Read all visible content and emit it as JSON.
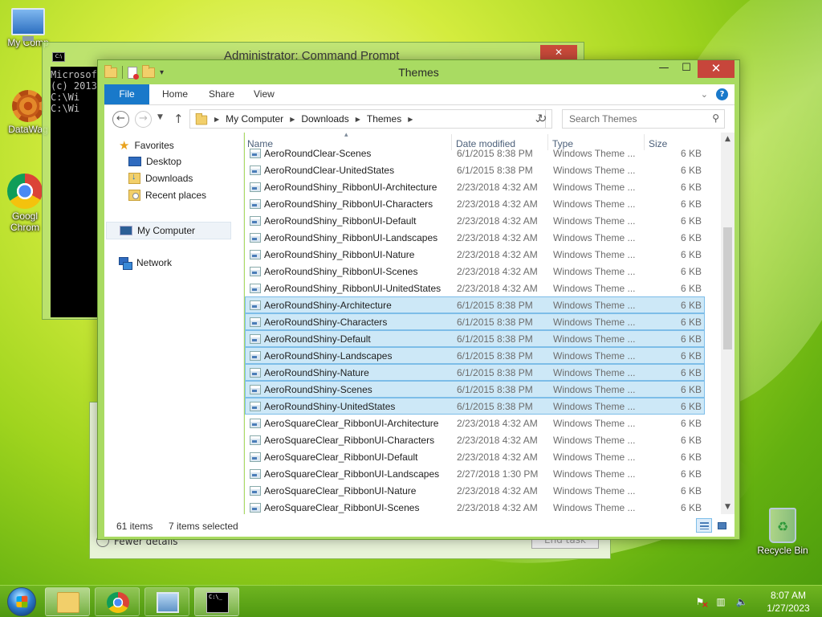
{
  "desktop": {
    "icons": [
      {
        "label": "My Comp"
      },
      {
        "label": "DataWag"
      },
      {
        "label": "Googl Chrom"
      },
      {
        "label": "Recycle Bin"
      }
    ]
  },
  "cmd_window": {
    "title": "Administrator:  Command Prompt",
    "lines": [
      "Microsof",
      "(c) 2013",
      "",
      "C:\\Wi",
      "",
      "C:\\Wi"
    ]
  },
  "task_window": {
    "fewer_details": "Fewer details",
    "end_task": "End task"
  },
  "explorer": {
    "title": "Themes",
    "ribbon_tabs": [
      "File",
      "Home",
      "Share",
      "View"
    ],
    "breadcrumb": [
      "My Computer",
      "Downloads",
      "Themes"
    ],
    "search_placeholder": "Search Themes",
    "nav": {
      "favorites": "Favorites",
      "desktop": "Desktop",
      "downloads": "Downloads",
      "recent": "Recent places",
      "my_computer": "My Computer",
      "network": "Network"
    },
    "columns": {
      "name": "Name",
      "date": "Date modified",
      "type": "Type",
      "size": "Size"
    },
    "files": [
      {
        "name": "AeroRoundClear-Scenes",
        "date": "6/1/2015 8:38 PM",
        "type": "Windows Theme ...",
        "size": "6 KB",
        "selected": false
      },
      {
        "name": "AeroRoundClear-UnitedStates",
        "date": "6/1/2015 8:38 PM",
        "type": "Windows Theme ...",
        "size": "6 KB",
        "selected": false
      },
      {
        "name": "AeroRoundShiny_RibbonUI-Architecture",
        "date": "2/23/2018 4:32 AM",
        "type": "Windows Theme ...",
        "size": "6 KB",
        "selected": false
      },
      {
        "name": "AeroRoundShiny_RibbonUI-Characters",
        "date": "2/23/2018 4:32 AM",
        "type": "Windows Theme ...",
        "size": "6 KB",
        "selected": false
      },
      {
        "name": "AeroRoundShiny_RibbonUI-Default",
        "date": "2/23/2018 4:32 AM",
        "type": "Windows Theme ...",
        "size": "6 KB",
        "selected": false
      },
      {
        "name": "AeroRoundShiny_RibbonUI-Landscapes",
        "date": "2/23/2018 4:32 AM",
        "type": "Windows Theme ...",
        "size": "6 KB",
        "selected": false
      },
      {
        "name": "AeroRoundShiny_RibbonUI-Nature",
        "date": "2/23/2018 4:32 AM",
        "type": "Windows Theme ...",
        "size": "6 KB",
        "selected": false
      },
      {
        "name": "AeroRoundShiny_RibbonUI-Scenes",
        "date": "2/23/2018 4:32 AM",
        "type": "Windows Theme ...",
        "size": "6 KB",
        "selected": false
      },
      {
        "name": "AeroRoundShiny_RibbonUI-UnitedStates",
        "date": "2/23/2018 4:32 AM",
        "type": "Windows Theme ...",
        "size": "6 KB",
        "selected": false
      },
      {
        "name": "AeroRoundShiny-Architecture",
        "date": "6/1/2015 8:38 PM",
        "type": "Windows Theme ...",
        "size": "6 KB",
        "selected": true
      },
      {
        "name": "AeroRoundShiny-Characters",
        "date": "6/1/2015 8:38 PM",
        "type": "Windows Theme ...",
        "size": "6 KB",
        "selected": true
      },
      {
        "name": "AeroRoundShiny-Default",
        "date": "6/1/2015 8:38 PM",
        "type": "Windows Theme ...",
        "size": "6 KB",
        "selected": true
      },
      {
        "name": "AeroRoundShiny-Landscapes",
        "date": "6/1/2015 8:38 PM",
        "type": "Windows Theme ...",
        "size": "6 KB",
        "selected": true
      },
      {
        "name": "AeroRoundShiny-Nature",
        "date": "6/1/2015 8:38 PM",
        "type": "Windows Theme ...",
        "size": "6 KB",
        "selected": true
      },
      {
        "name": "AeroRoundShiny-Scenes",
        "date": "6/1/2015 8:38 PM",
        "type": "Windows Theme ...",
        "size": "6 KB",
        "selected": true
      },
      {
        "name": "AeroRoundShiny-UnitedStates",
        "date": "6/1/2015 8:38 PM",
        "type": "Windows Theme ...",
        "size": "6 KB",
        "selected": true
      },
      {
        "name": "AeroSquareClear_RibbonUI-Architecture",
        "date": "2/23/2018 4:32 AM",
        "type": "Windows Theme ...",
        "size": "6 KB",
        "selected": false
      },
      {
        "name": "AeroSquareClear_RibbonUI-Characters",
        "date": "2/23/2018 4:32 AM",
        "type": "Windows Theme ...",
        "size": "6 KB",
        "selected": false
      },
      {
        "name": "AeroSquareClear_RibbonUI-Default",
        "date": "2/23/2018 4:32 AM",
        "type": "Windows Theme ...",
        "size": "6 KB",
        "selected": false
      },
      {
        "name": "AeroSquareClear_RibbonUI-Landscapes",
        "date": "2/27/2018 1:30 PM",
        "type": "Windows Theme ...",
        "size": "6 KB",
        "selected": false
      },
      {
        "name": "AeroSquareClear_RibbonUI-Nature",
        "date": "2/23/2018 4:32 AM",
        "type": "Windows Theme ...",
        "size": "6 KB",
        "selected": false
      },
      {
        "name": "AeroSquareClear_RibbonUI-Scenes",
        "date": "2/23/2018 4:32 AM",
        "type": "Windows Theme ...",
        "size": "6 KB",
        "selected": false
      }
    ],
    "status": {
      "item_count": "61 items",
      "selected_count": "7 items selected"
    }
  },
  "taskbar": {
    "time": "8:07 AM",
    "date": "1/27/2023"
  },
  "colors": {
    "accent_blue": "#1979ca",
    "selection_fill": "#cde8f7",
    "selection_border": "#7dbde8",
    "close_red": "#c7463b"
  }
}
